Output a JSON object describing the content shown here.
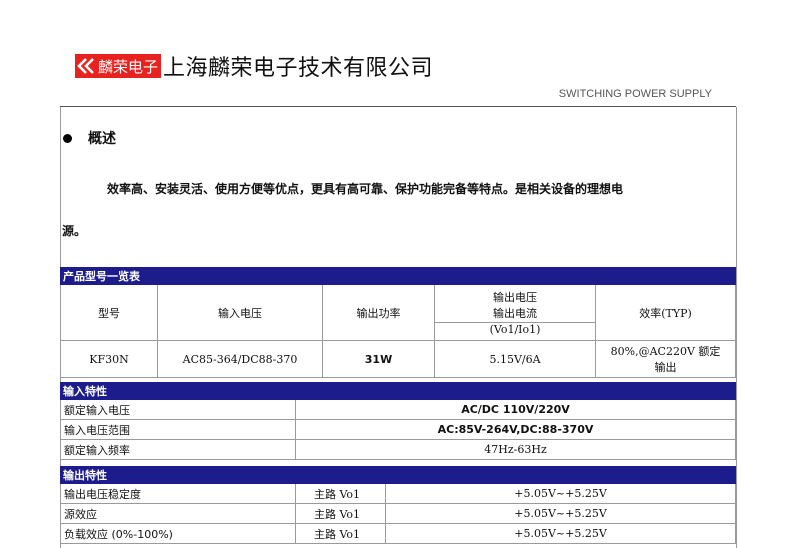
{
  "header": {
    "logo_text": "麟荣电子",
    "company_name": "上海麟荣电子技术有限公司",
    "tagline": "SWITCHING POWER SUPPLY",
    "brand_color": "#e8231f",
    "band_color": "#1c1c8c"
  },
  "overview": {
    "title": "概述",
    "para_line1": "效率高、安装灵活、使用方便等优点，更具有高可靠、保护功能完备等特点。是相关设备的理想电",
    "para_line2": "源。"
  },
  "product_table": {
    "band": "产品型号一览表",
    "headers": {
      "model": "型号",
      "input_voltage": "输入电压",
      "output_power": "输出功率",
      "output_line1": "输出电压",
      "output_line2": "输出电流",
      "output_line3": "(Vo1/Io1)",
      "efficiency": "效率(TYP)"
    },
    "row": {
      "model": "KF30N",
      "input_voltage": "AC85-364/DC88-370",
      "output_power": "31W",
      "output": "5.15V/6A",
      "efficiency_line1": "80%,@AC220V 额定",
      "efficiency_line2": "输出"
    }
  },
  "input_table": {
    "band": "输入特性",
    "rows": [
      {
        "label": "额定输入电压",
        "value": "AC/DC 110V/220V"
      },
      {
        "label": "输入电压范围",
        "value": "AC:85V-264V,DC:88-370V"
      },
      {
        "label": "额定输入频率",
        "value": "47Hz-63Hz"
      }
    ]
  },
  "output_table": {
    "band": "输出特性",
    "rows": [
      {
        "label": "输出电压稳定度",
        "channel": "主路 Vo1",
        "value": "+5.05V~+5.25V"
      },
      {
        "label": "源效应",
        "channel": "主路 Vo1",
        "value": "+5.05V~+5.25V"
      },
      {
        "label": "负载效应 (0%-100%)",
        "channel": "主路 Vo1",
        "value": "+5.05V~+5.25V"
      }
    ]
  }
}
